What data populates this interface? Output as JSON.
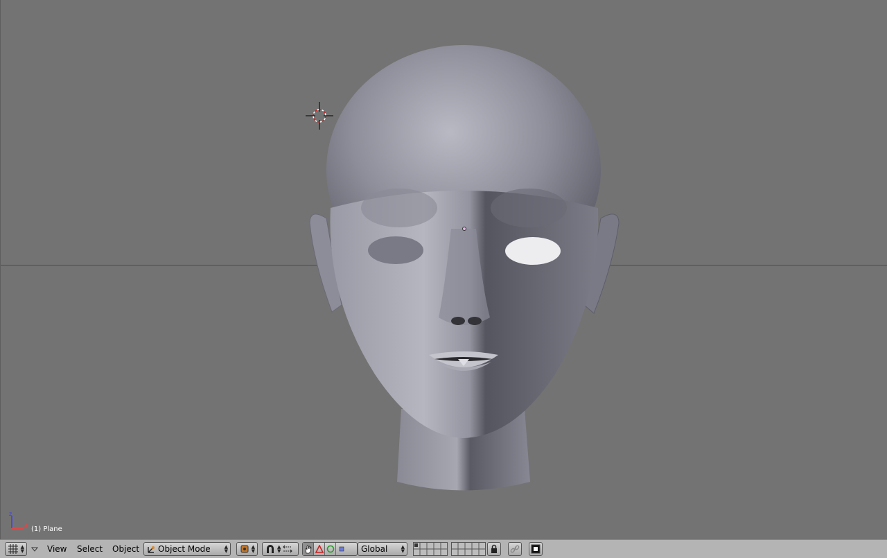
{
  "viewport": {
    "object_label": "(1) Plane",
    "axis_labels": {
      "x": "x",
      "z": "z"
    }
  },
  "header": {
    "menus": {
      "view": "View",
      "select": "Select",
      "object": "Object"
    },
    "mode": "Object Mode",
    "orientation": "Global"
  },
  "colors": {
    "viewport_bg": "#737373",
    "header_bg": "#b4b4b4",
    "mesh": "#8c8c98",
    "cursor_red": "#cc2222"
  }
}
